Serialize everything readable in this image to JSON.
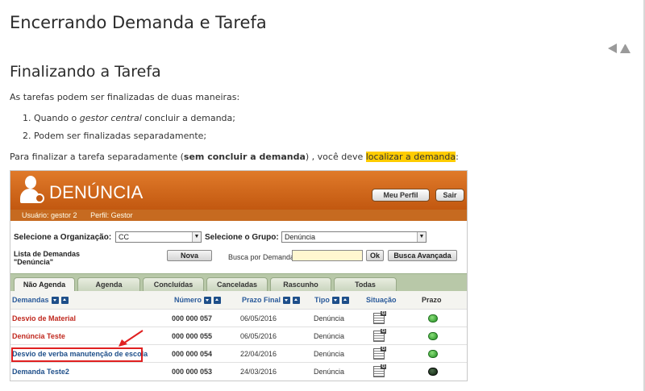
{
  "page": {
    "title": "Encerrando Demanda e Tarefa",
    "section_title": "Finalizando a Tarefa",
    "intro": "As tarefas podem ser finalizadas de duas maneiras:",
    "list": [
      {
        "pre": "1. Quando o ",
        "em": "gestor central",
        "post": " concluir a demanda;"
      },
      {
        "pre": "2. Podem ser finalizadas separadamente;",
        "em": "",
        "post": ""
      }
    ],
    "para2": {
      "pre": "Para finalizar a tarefa separadamente (",
      "bold": "sem concluir a demanda",
      "mid": ") , você deve ",
      "highlight": "localizar a demanda",
      "post": ":"
    },
    "nav": {
      "prev_icon": "triangle-left-icon",
      "top_icon": "triangle-up-icon"
    }
  },
  "app": {
    "title": "DENÚNCIA",
    "logo_icon": "user-badge-icon",
    "buttons": {
      "perfil": "Meu Perfil",
      "sair": "Sair"
    },
    "user_bar": {
      "usuario": "Usuário: gestor 2",
      "perfil": "Perfil: Gestor"
    },
    "filters": {
      "org_label": "Selecione a Organização:",
      "org_value": "CC",
      "group_label": "Selecione o Grupo:",
      "group_value": "Denúncia"
    },
    "toolbar": {
      "list_label_line1": "Lista de Demandas",
      "list_label_line2": "\"Denúncia\"",
      "nova": "Nova",
      "busca_label": "Busca por Demandas:",
      "ok": "Ok",
      "avancada": "Busca Avançada"
    },
    "tabs": [
      "Não Agenda",
      "Agenda",
      "Concluídas",
      "Canceladas",
      "Rascunho",
      "Todas"
    ],
    "columns": {
      "demandas": "Demandas",
      "numero": "Número",
      "prazo_final": "Prazo Final",
      "tipo": "Tipo",
      "situacao": "Situação",
      "prazo": "Prazo"
    },
    "rows": [
      {
        "demanda": "Desvio de Material",
        "numero": "000 000 057",
        "prazo_final": "06/05/2016",
        "tipo": "Denúncia",
        "color": "#c0281e",
        "status": "green"
      },
      {
        "demanda": "Denúncia Teste",
        "numero": "000 000 055",
        "prazo_final": "06/05/2016",
        "tipo": "Denúncia",
        "color": "#c0281e",
        "status": "green"
      },
      {
        "demanda": "Desvio de verba manutenção de escola",
        "numero": "000 000 054",
        "prazo_final": "22/04/2016",
        "tipo": "Denúncia",
        "color": "#1e4f8a",
        "status": "green"
      },
      {
        "demanda": "Demanda Teste2",
        "numero": "000 000 053",
        "prazo_final": "24/03/2016",
        "tipo": "Denúncia",
        "color": "#1e4f8a",
        "status": "dark"
      }
    ],
    "colors": {
      "header": "#d06a20",
      "highlight_box": "#e02020",
      "accent_highlight": "#ffcc00"
    }
  }
}
